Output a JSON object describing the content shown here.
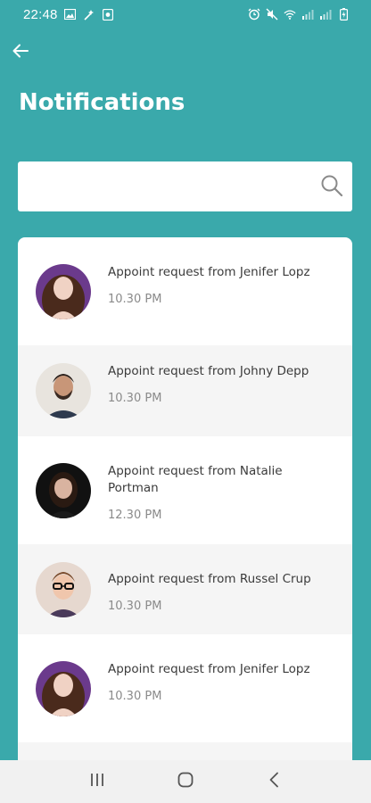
{
  "status_bar": {
    "time": "22:48",
    "left_icons": [
      "image-icon",
      "wand-icon",
      "app-icon"
    ],
    "right_icons": [
      "alarm-icon",
      "mute-icon",
      "wifi-icon",
      "signal-icon",
      "signal-icon",
      "battery-icon"
    ]
  },
  "header": {
    "title": "Notifications",
    "back_icon": "arrow-left-icon"
  },
  "search": {
    "value": "",
    "placeholder": "",
    "icon": "search-icon"
  },
  "notifications": [
    {
      "title": "Appoint request from Jenifer Lopz",
      "time": "10.30 PM",
      "avatar": "woman-purple"
    },
    {
      "title": "Appoint request from Johny Depp",
      "time": "10.30 PM",
      "avatar": "man-beard"
    },
    {
      "title": "Appoint request from Natalie Portman",
      "time": "12.30 PM",
      "avatar": "woman-dark"
    },
    {
      "title": "Appoint request from Russel Crup",
      "time": "10.30 PM",
      "avatar": "man-glasses"
    },
    {
      "title": "Appoint request from Jenifer Lopz",
      "time": "10.30 PM",
      "avatar": "woman-purple"
    }
  ],
  "nav_bar": {
    "icons": [
      "recent-apps-icon",
      "home-icon",
      "back-icon"
    ]
  },
  "colors": {
    "background": "#3aa9ab",
    "card": "#ffffff",
    "alt_row": "#f5f5f5"
  }
}
